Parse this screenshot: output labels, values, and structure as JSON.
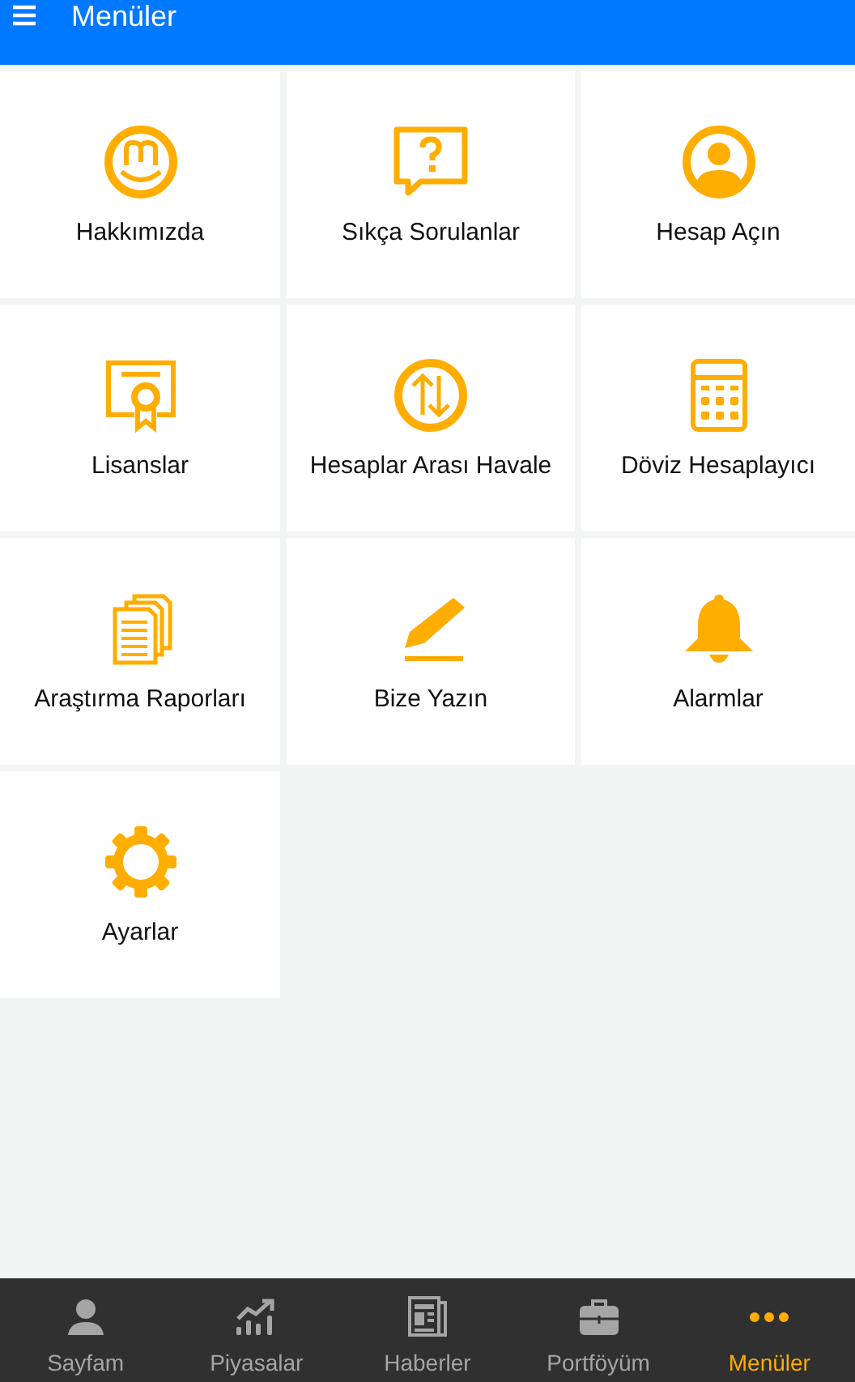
{
  "header": {
    "title": "Menüler"
  },
  "menu_items": [
    {
      "label": "Hakkımızda",
      "kind": "logo"
    },
    {
      "label": "Sıkça Sorulanlar",
      "kind": "question"
    },
    {
      "label": "Hesap Açın",
      "kind": "user"
    },
    {
      "label": "Lisanslar",
      "kind": "certificate"
    },
    {
      "label": "Hesaplar Arası Havale",
      "kind": "transfer"
    },
    {
      "label": "Döviz Hesaplayıcı",
      "kind": "calculator"
    },
    {
      "label": "Araştırma Raporları",
      "kind": "documents"
    },
    {
      "label": "Bize Yazın",
      "kind": "pencil"
    },
    {
      "label": "Alarmlar",
      "kind": "bell"
    },
    {
      "label": "Ayarlar",
      "kind": "gear"
    }
  ],
  "tab_bar": [
    {
      "label": "Sayfam",
      "kind": "person",
      "selected": false
    },
    {
      "label": "Piyasalar",
      "kind": "chart",
      "selected": false
    },
    {
      "label": "Haberler",
      "kind": "news",
      "selected": false
    },
    {
      "label": "Portföyüm",
      "kind": "briefcase",
      "selected": false
    },
    {
      "label": "Menüler",
      "kind": "dots",
      "selected": true
    }
  ]
}
